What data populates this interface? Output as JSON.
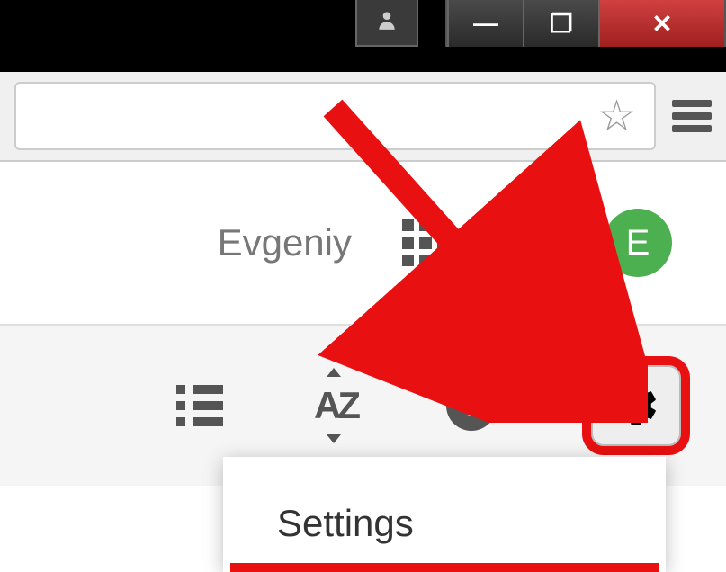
{
  "window": {
    "minimize_glyph": "—",
    "maximize_glyph": "❐",
    "close_glyph": "✕",
    "user_glyph": "👤"
  },
  "browser": {
    "star_glyph": "☆"
  },
  "account": {
    "name": "Evgeniy",
    "avatar_initial": "E"
  },
  "toolbar": {
    "sort_label": "AZ",
    "info_glyph": "i",
    "gear_label": "Settings gear"
  },
  "dropdown": {
    "settings_label": "Settings"
  }
}
